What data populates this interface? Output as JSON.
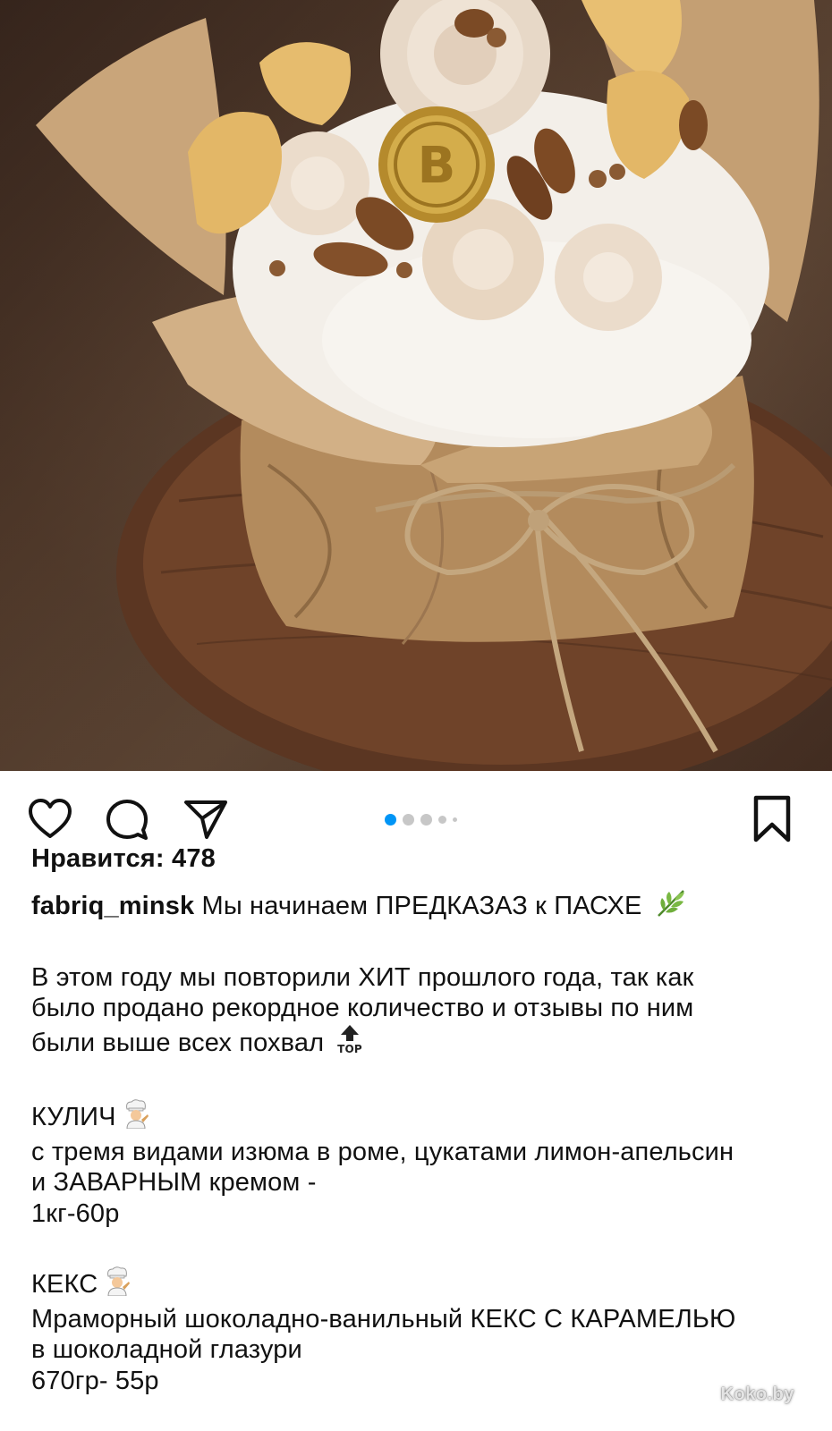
{
  "post": {
    "image_alt": "Кулич в крафтовой бумаге с безе, миндалём и золотой медалью",
    "carousel": {
      "total": 5,
      "active": 1
    },
    "likes_text": "Нравится: 478",
    "username": "fabriq_minsk",
    "caption": {
      "headline": "Мы начинаем ПРЕДКАЗАЗ к ПАСХЕ",
      "paragraph1_lines": [
        "В этом году мы повторили ХИТ прошлого года, так как",
        "было продано рекордное количество и отзывы по ним",
        "были выше всех похвал"
      ],
      "item1": {
        "title": "КУЛИЧ",
        "desc_lines": [
          "с тремя видами изюма в роме, цукатами лимон-апельсин",
          "и ЗАВАРНЫМ кремом -"
        ],
        "price": "1кг-60р"
      },
      "item2": {
        "title": "КЕКС",
        "desc_lines": [
          "Мраморный шоколадно-ванильный КЕКС С КАРАМЕЛЬЮ",
          "в шоколадной глазури"
        ],
        "price": "670гр- 55р"
      }
    },
    "emoji": {
      "herb": "herb-emoji",
      "top": "top-arrow-emoji",
      "cook": "cook-emoji",
      "top_label": "TOP"
    }
  },
  "icons": {
    "heart": "heart-icon",
    "comment": "comment-icon",
    "share": "paper-plane-icon",
    "bookmark": "bookmark-icon"
  },
  "colors": {
    "accent_dot": "#0095f6",
    "inactive_dot": "#c7c7c7",
    "text": "#111111"
  },
  "watermark": "Koko.by"
}
